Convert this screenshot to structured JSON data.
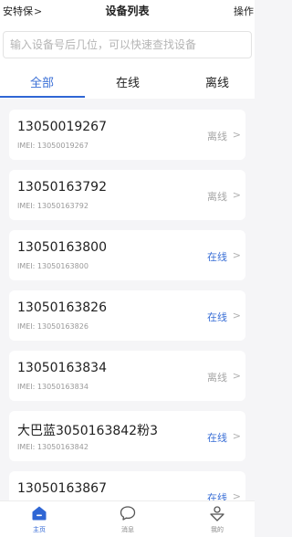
{
  "header": {
    "left_label": "安特保",
    "title": "设备列表",
    "right_label": "操作"
  },
  "search": {
    "placeholder": "输入设备号后几位，可以快速查找设备",
    "value": ""
  },
  "tabs": [
    {
      "label": "全部",
      "active": true
    },
    {
      "label": "在线",
      "active": false
    },
    {
      "label": "离线",
      "active": false
    }
  ],
  "devices": [
    {
      "name": "13050019267",
      "imei": "IMEI: 13050019267",
      "status": "离线",
      "online": false
    },
    {
      "name": "13050163792",
      "imei": "IMEI: 13050163792",
      "status": "离线",
      "online": false
    },
    {
      "name": "13050163800",
      "imei": "IMEI: 13050163800",
      "status": "在线",
      "online": true
    },
    {
      "name": "13050163826",
      "imei": "IMEI: 13050163826",
      "status": "在线",
      "online": true
    },
    {
      "name": "13050163834",
      "imei": "IMEI: 13050163834",
      "status": "离线",
      "online": false
    },
    {
      "name": "大巴蓝3050163842粉3",
      "imei": "IMEI: 13050163842",
      "status": "在线",
      "online": true
    },
    {
      "name": "13050163867",
      "imei": "",
      "status": "在线",
      "online": true
    }
  ],
  "bottom_nav": [
    {
      "label": "主页",
      "icon": "home-icon",
      "active": true
    },
    {
      "label": "消息",
      "icon": "message-icon",
      "active": false
    },
    {
      "label": "我的",
      "icon": "profile-icon",
      "active": false
    }
  ],
  "colors": {
    "accent": "#2f66d4",
    "online": "#3a6fd6",
    "offline": "#a6a6a6",
    "background": "#f5f5f7"
  }
}
